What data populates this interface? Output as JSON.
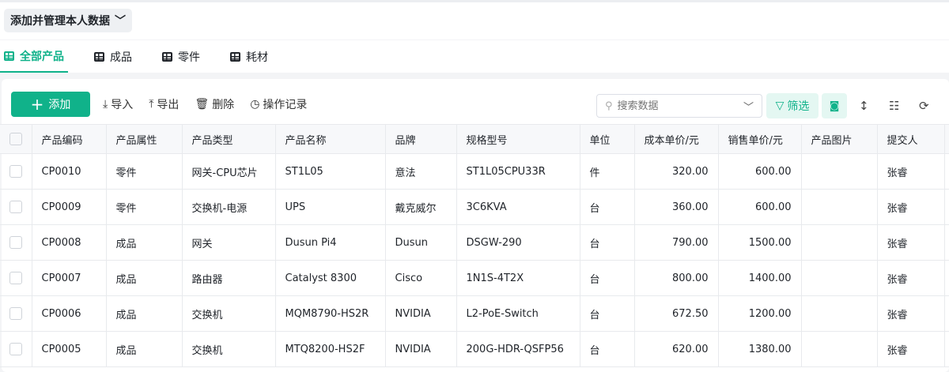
{
  "header": {
    "scope_label": "添加并管理本人数据"
  },
  "tabs": [
    {
      "label": "全部产品"
    },
    {
      "label": "成品"
    },
    {
      "label": "零件"
    },
    {
      "label": "耗材"
    }
  ],
  "toolbar": {
    "add": "添加",
    "import": "导入",
    "export": "导出",
    "delete": "删除",
    "history": "操作记录",
    "search_placeholder": "搜索数据",
    "filter": "筛选"
  },
  "colors": {
    "accent": "#10b28a"
  },
  "table": {
    "columns": [
      "产品编码",
      "产品属性",
      "产品类型",
      "产品名称",
      "品牌",
      "规格型号",
      "单位",
      "成本单价/元",
      "销售单价/元",
      "产品图片",
      "提交人"
    ],
    "rows": [
      [
        "CP0010",
        "零件",
        "网关-CPU芯片",
        "ST1L05",
        "意法",
        "ST1L05CPU33R",
        "件",
        "320.00",
        "600.00",
        "",
        "张睿"
      ],
      [
        "CP0009",
        "零件",
        "交换机-电源",
        "UPS",
        "戴克威尔",
        "3C6KVA",
        "台",
        "360.00",
        "600.00",
        "",
        "张睿"
      ],
      [
        "CP0008",
        "成品",
        "网关",
        "Dusun Pi4",
        "Dusun",
        "DSGW-290",
        "台",
        "790.00",
        "1500.00",
        "",
        "张睿"
      ],
      [
        "CP0007",
        "成品",
        "路由器",
        "Catalyst 8300",
        "Cisco",
        "1N1S-4T2X",
        "台",
        "800.00",
        "1400.00",
        "",
        "张睿"
      ],
      [
        "CP0006",
        "成品",
        "交换机",
        "MQM8790-HS2R",
        "NVIDIA",
        "L2-PoE-Switch",
        "台",
        "672.50",
        "1200.00",
        "",
        "张睿"
      ],
      [
        "CP0005",
        "成品",
        "交换机",
        "MTQ8200-HS2F",
        "NVIDIA",
        "200G-HDR-QSFP56",
        "台",
        "620.00",
        "1380.00",
        "",
        "张睿"
      ]
    ]
  }
}
